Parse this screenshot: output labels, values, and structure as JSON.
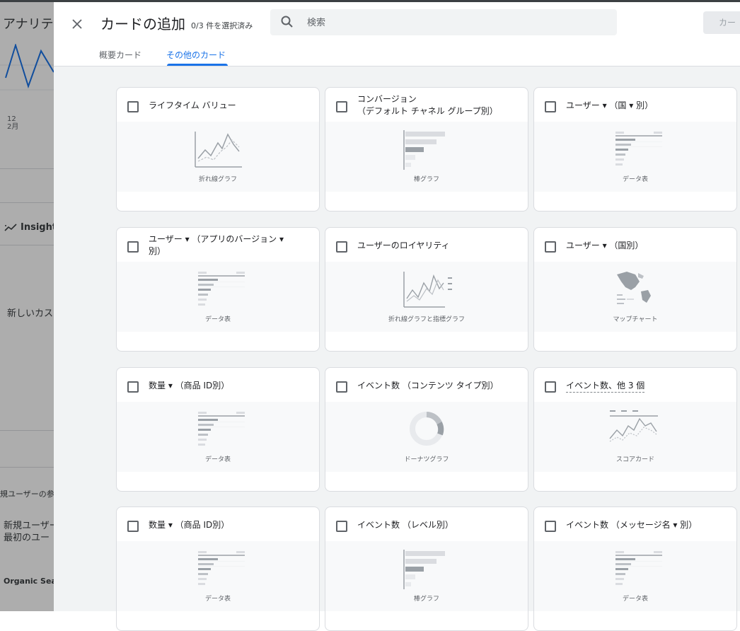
{
  "background": {
    "title": "アナリティ",
    "date_day": "12",
    "date_month": "2月",
    "insights_label": "Insights",
    "new_custom": "新しいカス",
    "new_users_label": "規ユーザーの参",
    "new_users_line1": "新規ユーザー",
    "new_users_line2": "最初のユー",
    "organic_label": "Organic Sear"
  },
  "panel": {
    "title": "カードの追加",
    "selected_count": "0/3 件を選択済み",
    "search_placeholder": "検索",
    "add_button_label": "カー",
    "tabs": [
      {
        "label": "概要カード",
        "active": false
      },
      {
        "label": "その他のカード",
        "active": true
      }
    ]
  },
  "cards": [
    {
      "title": "ライフタイム バリュー",
      "preview": "line",
      "preview_label": "折れ線グラフ"
    },
    {
      "title": "コンバージョン\n（デフォルト チャネル グループ別）",
      "preview": "bar",
      "preview_label": "棒グラフ"
    },
    {
      "title": "ユーザー ▾ （国 ▾ 別）",
      "preview": "table",
      "preview_label": "データ表"
    },
    {
      "title": "ユーザー ▾ （アプリのバージョン ▾\n別）",
      "preview": "table",
      "preview_label": "データ表"
    },
    {
      "title": "ユーザーのロイヤリティ",
      "preview": "line-metric",
      "preview_label": "折れ線グラフと指標グラフ"
    },
    {
      "title": "ユーザー ▾ （国別）",
      "preview": "map",
      "preview_label": "マップチャート"
    },
    {
      "title": "数量 ▾ （商品 ID別）",
      "preview": "table",
      "preview_label": "データ表"
    },
    {
      "title": "イベント数 （コンテンツ タイプ別）",
      "preview": "donut",
      "preview_label": "ドーナツグラフ"
    },
    {
      "title": "イベント数、他 3 個",
      "preview": "scorecard",
      "preview_label": "スコアカード"
    },
    {
      "title": "数量 ▾ （商品 ID別）",
      "preview": "table",
      "preview_label": "データ表"
    },
    {
      "title": "イベント数 （レベル別）",
      "preview": "bar",
      "preview_label": "棒グラフ"
    },
    {
      "title": "イベント数 （メッセージ名 ▾ 別）",
      "preview": "table",
      "preview_label": "データ表"
    }
  ]
}
